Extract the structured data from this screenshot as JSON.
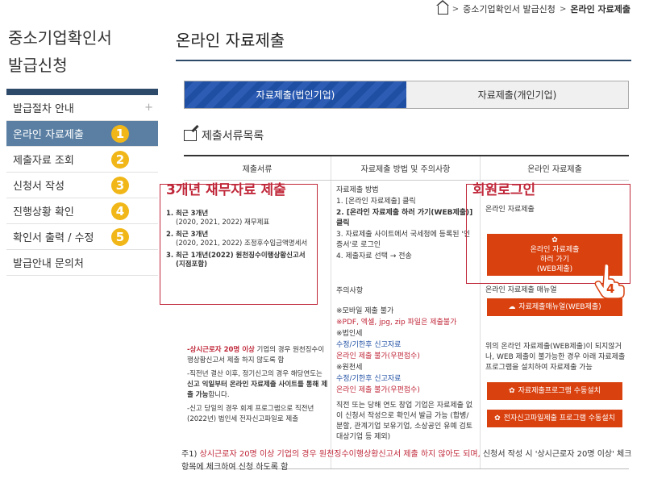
{
  "breadcrumb": {
    "items": [
      "중소기업확인서 발급신청",
      "온라인 자료제출"
    ],
    "separator": ">"
  },
  "sidebar": {
    "title_line1": "중소기업확인서",
    "title_line2": "발급신청",
    "items": [
      {
        "label": "발급절차 안내",
        "suffix": "+"
      },
      {
        "label": "온라인 자료제출",
        "badge": "1"
      },
      {
        "label": "제출자료 조회",
        "badge": "2"
      },
      {
        "label": "신청서 작성",
        "badge": "3"
      },
      {
        "label": "진행상황 확인",
        "badge": "4"
      },
      {
        "label": "확인서 출력 / 수정",
        "badge": "5"
      },
      {
        "label": "발급안내 문의처"
      }
    ]
  },
  "main": {
    "title": "온라인 자료제출",
    "tabs": [
      {
        "label": "자료제출(법인기업)",
        "active": true
      },
      {
        "label": "자료제출(개인기업)",
        "active": false
      }
    ],
    "section_title": "제출서류목록",
    "table": {
      "headers": [
        "제출서류",
        "자료제출 방법 및 주의사항",
        "온라인 자료제출"
      ],
      "col1": {
        "annotation": "3개년 재무자료 제출",
        "items": [
          {
            "num": "1.",
            "title": "최근 3개년",
            "detail": "(2020, 2021, 2022) 재무제표"
          },
          {
            "num": "2.",
            "title": "최근 3개년",
            "detail": "(2020, 2021, 2022) 조정후수입금액명세서"
          },
          {
            "num": "3.",
            "title": "최근 1개년(2022) 원천징수이행상황신고서",
            "detail": "(지점포함)"
          }
        ],
        "note1_red": "-상시근로자 20명 이상",
        "note1_rest": " 기업의 경우 원천징수이행상황신고서 제출 하지 않도록 함",
        "note2_a": "-직전년 결산 이후, 정기신고의 경우 해당연도는 ",
        "note2_b": "신고 익일부터 온라인 자료제출 사이트를 통해 제출 가능",
        "note2_c": "합니다.",
        "note3": "-신고 당일의 경우 회계 프로그램으로 직전년(2022년) 법인세 전자신고파일로 제출"
      },
      "col2": {
        "method_title": "자료제출 방법",
        "steps": [
          "1. [온라인 자료제출] 클릭",
          "2. [온라인 자료제출 하러 가기(WEB제출)] 클릭",
          "3. 자료제출 사이트에서 국세청에 등록된 '인증서'로 로그인",
          "4. 제출자료 선택 → 전송"
        ],
        "caution_title": "주의사항",
        "caution_items": [
          "※모바일 제출 불가",
          "※PDF, 엑셀, jpg, zip 파일은 제출불가",
          "※법인세",
          "수정/기한후 신고자료",
          "온라인 제출 불가(우편접수)",
          "※원천세",
          "수정/기한후 신고자료",
          "온라인 제출 불가(우편접수)"
        ],
        "final_note": "직전 또는 당해 연도 창업 기업은 자료제출 없이 신청서 작성으로 확인서 발급 가능 (합병/분할, 관계기업 보유기업, 소상공인 유예 검토 대상기업 등 제외)"
      },
      "col3": {
        "annotation": "회원로그인",
        "label1": "온라인 자료제출",
        "big_button_line1": "온라인 자료제출",
        "big_button_line2": "하러 가기",
        "big_button_line3": "(WEB제출)",
        "step_number": "4",
        "manual_label": "온라인 자료제출 매뉴얼",
        "manual_button": "자료제출매뉴얼(WEB제출)",
        "desc": "위의 온라인 자료제출(WEB제출)이 되지않거나, WEB 제출이 불가능한 경우 아래 자료제출프로그램을 설치하여 자료제출 가능",
        "install_button": "자료제출프로그램 수동설치",
        "e_filing_button": "전자신고파일제출 프로그램 수동설치"
      }
    }
  },
  "footnote": {
    "prefix": "주1) ",
    "red": "상시근로자 20명 이상 기업의 경우 원천징수이행상황신고서 제출 하지 않아도 되며,",
    "rest": " 신청서 작성 시 '상시근로자 20명 이상' 체크항목에 체크하여 신청 하도록 함"
  },
  "colors": {
    "navy": "#2e4a6b",
    "sidebar_active": "#5a7fa3",
    "tab_blue": "#1f4fa3",
    "orange_button": "#d9410f",
    "badge_yellow": "#f1b718",
    "annotation_red": "#c0283a"
  }
}
